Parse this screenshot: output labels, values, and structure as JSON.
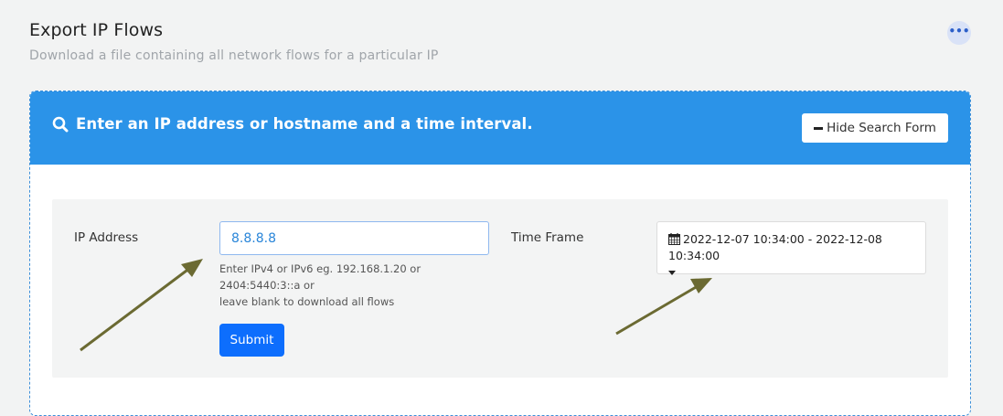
{
  "header": {
    "title": "Export IP Flows",
    "subtitle": "Download a file containing all network flows for a particular IP",
    "more_label": "•••"
  },
  "search_panel": {
    "title": "Enter an IP address or hostname and a time interval.",
    "hide_button_label": "Hide Search Form"
  },
  "form": {
    "ip_label": "IP Address",
    "ip_value": "8.8.8.8",
    "help_lines": [
      "Enter IPv4 or IPv6 eg. 192.168.1.20 or",
      "2404:5440:3::a or",
      "leave blank to download all flows"
    ],
    "submit_label": "Submit",
    "timeframe_label": "Time Frame",
    "timeframe_value": "2022-12-07 10:34:00 - 2022-12-08 10:34:00"
  },
  "colors": {
    "panel_header": "#2b93e8",
    "submit": "#0d6efd",
    "annotation_arrow": "#6b6a32"
  },
  "icons": [
    "search-icon",
    "minus-icon",
    "calendar-icon",
    "caret-down-icon",
    "more-icon"
  ]
}
